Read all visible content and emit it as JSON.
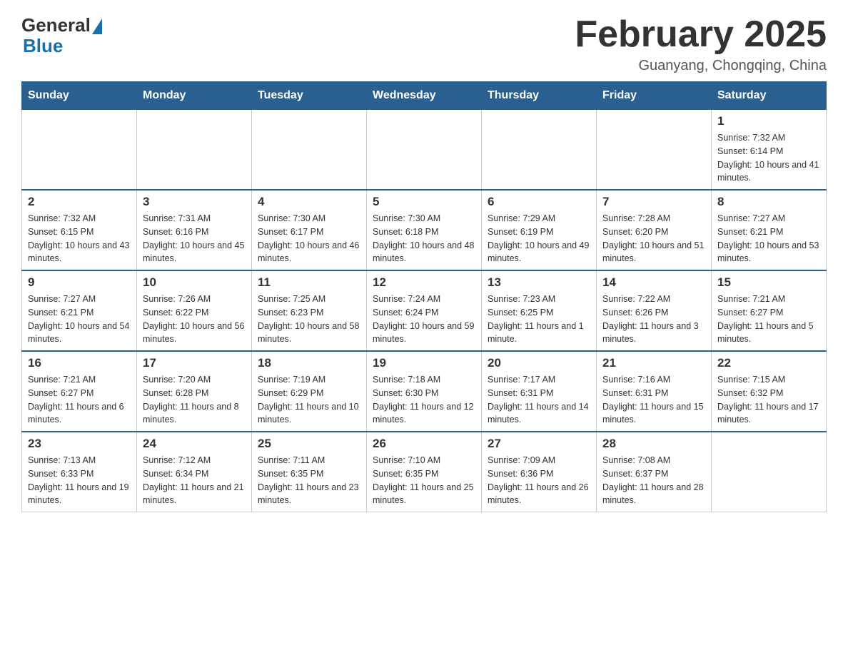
{
  "header": {
    "logo_general": "General",
    "logo_blue": "Blue",
    "month_title": "February 2025",
    "location": "Guanyang, Chongqing, China"
  },
  "days_of_week": [
    "Sunday",
    "Monday",
    "Tuesday",
    "Wednesday",
    "Thursday",
    "Friday",
    "Saturday"
  ],
  "weeks": [
    [
      {
        "day": "",
        "info": ""
      },
      {
        "day": "",
        "info": ""
      },
      {
        "day": "",
        "info": ""
      },
      {
        "day": "",
        "info": ""
      },
      {
        "day": "",
        "info": ""
      },
      {
        "day": "",
        "info": ""
      },
      {
        "day": "1",
        "info": "Sunrise: 7:32 AM\nSunset: 6:14 PM\nDaylight: 10 hours and 41 minutes."
      }
    ],
    [
      {
        "day": "2",
        "info": "Sunrise: 7:32 AM\nSunset: 6:15 PM\nDaylight: 10 hours and 43 minutes."
      },
      {
        "day": "3",
        "info": "Sunrise: 7:31 AM\nSunset: 6:16 PM\nDaylight: 10 hours and 45 minutes."
      },
      {
        "day": "4",
        "info": "Sunrise: 7:30 AM\nSunset: 6:17 PM\nDaylight: 10 hours and 46 minutes."
      },
      {
        "day": "5",
        "info": "Sunrise: 7:30 AM\nSunset: 6:18 PM\nDaylight: 10 hours and 48 minutes."
      },
      {
        "day": "6",
        "info": "Sunrise: 7:29 AM\nSunset: 6:19 PM\nDaylight: 10 hours and 49 minutes."
      },
      {
        "day": "7",
        "info": "Sunrise: 7:28 AM\nSunset: 6:20 PM\nDaylight: 10 hours and 51 minutes."
      },
      {
        "day": "8",
        "info": "Sunrise: 7:27 AM\nSunset: 6:21 PM\nDaylight: 10 hours and 53 minutes."
      }
    ],
    [
      {
        "day": "9",
        "info": "Sunrise: 7:27 AM\nSunset: 6:21 PM\nDaylight: 10 hours and 54 minutes."
      },
      {
        "day": "10",
        "info": "Sunrise: 7:26 AM\nSunset: 6:22 PM\nDaylight: 10 hours and 56 minutes."
      },
      {
        "day": "11",
        "info": "Sunrise: 7:25 AM\nSunset: 6:23 PM\nDaylight: 10 hours and 58 minutes."
      },
      {
        "day": "12",
        "info": "Sunrise: 7:24 AM\nSunset: 6:24 PM\nDaylight: 10 hours and 59 minutes."
      },
      {
        "day": "13",
        "info": "Sunrise: 7:23 AM\nSunset: 6:25 PM\nDaylight: 11 hours and 1 minute."
      },
      {
        "day": "14",
        "info": "Sunrise: 7:22 AM\nSunset: 6:26 PM\nDaylight: 11 hours and 3 minutes."
      },
      {
        "day": "15",
        "info": "Sunrise: 7:21 AM\nSunset: 6:27 PM\nDaylight: 11 hours and 5 minutes."
      }
    ],
    [
      {
        "day": "16",
        "info": "Sunrise: 7:21 AM\nSunset: 6:27 PM\nDaylight: 11 hours and 6 minutes."
      },
      {
        "day": "17",
        "info": "Sunrise: 7:20 AM\nSunset: 6:28 PM\nDaylight: 11 hours and 8 minutes."
      },
      {
        "day": "18",
        "info": "Sunrise: 7:19 AM\nSunset: 6:29 PM\nDaylight: 11 hours and 10 minutes."
      },
      {
        "day": "19",
        "info": "Sunrise: 7:18 AM\nSunset: 6:30 PM\nDaylight: 11 hours and 12 minutes."
      },
      {
        "day": "20",
        "info": "Sunrise: 7:17 AM\nSunset: 6:31 PM\nDaylight: 11 hours and 14 minutes."
      },
      {
        "day": "21",
        "info": "Sunrise: 7:16 AM\nSunset: 6:31 PM\nDaylight: 11 hours and 15 minutes."
      },
      {
        "day": "22",
        "info": "Sunrise: 7:15 AM\nSunset: 6:32 PM\nDaylight: 11 hours and 17 minutes."
      }
    ],
    [
      {
        "day": "23",
        "info": "Sunrise: 7:13 AM\nSunset: 6:33 PM\nDaylight: 11 hours and 19 minutes."
      },
      {
        "day": "24",
        "info": "Sunrise: 7:12 AM\nSunset: 6:34 PM\nDaylight: 11 hours and 21 minutes."
      },
      {
        "day": "25",
        "info": "Sunrise: 7:11 AM\nSunset: 6:35 PM\nDaylight: 11 hours and 23 minutes."
      },
      {
        "day": "26",
        "info": "Sunrise: 7:10 AM\nSunset: 6:35 PM\nDaylight: 11 hours and 25 minutes."
      },
      {
        "day": "27",
        "info": "Sunrise: 7:09 AM\nSunset: 6:36 PM\nDaylight: 11 hours and 26 minutes."
      },
      {
        "day": "28",
        "info": "Sunrise: 7:08 AM\nSunset: 6:37 PM\nDaylight: 11 hours and 28 minutes."
      },
      {
        "day": "",
        "info": ""
      }
    ]
  ]
}
